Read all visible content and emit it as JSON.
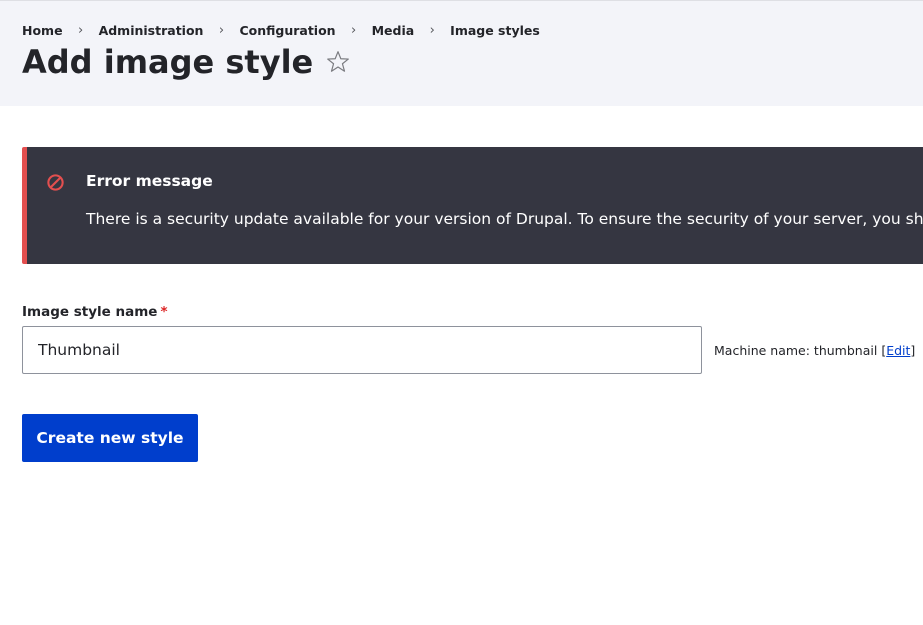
{
  "breadcrumb": {
    "items": [
      "Home",
      "Administration",
      "Configuration",
      "Media",
      "Image styles"
    ],
    "separator": "›"
  },
  "page": {
    "title": "Add image style",
    "favorite_icon": "star-outline-icon"
  },
  "error_message": {
    "icon": "error-circle-slash-icon",
    "title": "Error message",
    "text": "There is a security update available for your version of Drupal. To ensure the security of your server, you should update immediately!",
    "accent_color": "#e34f4f",
    "background_color": "#353641"
  },
  "form": {
    "name_label": "Image style name",
    "required_marker": "*",
    "name_value": "Thumbnail",
    "machine_name_prefix": "Machine name: thumbnail",
    "machine_name_open_bracket": "[",
    "machine_name_edit": "Edit",
    "machine_name_close_bracket": "]",
    "submit_label": "Create new style"
  },
  "colors": {
    "primary": "#003ecc",
    "header_bg": "#f3f4f9",
    "required": "#dc2323"
  }
}
